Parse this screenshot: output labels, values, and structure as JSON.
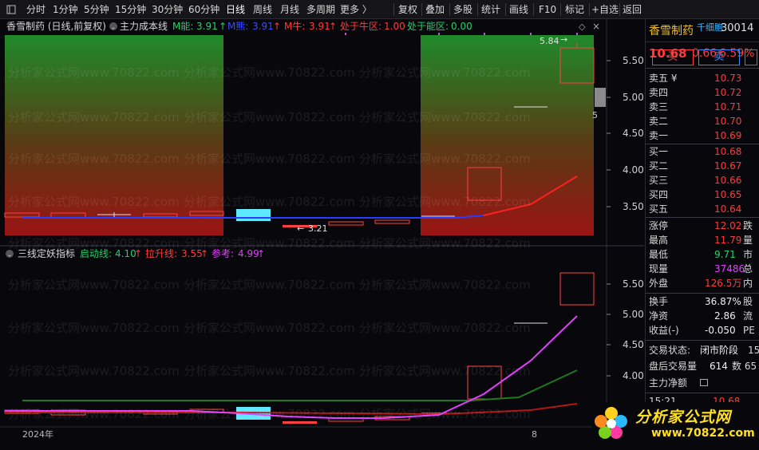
{
  "toolbar": {
    "items": [
      "分时",
      "1分钟",
      "5分钟",
      "15分钟",
      "30分钟",
      "60分钟",
      "日线",
      "周线",
      "月线",
      "多周期",
      "更多 〉",
      "复权",
      "叠加",
      "多股",
      "统计",
      "画线",
      "F10",
      "标记",
      "+自选",
      "返回"
    ],
    "active": "日线"
  },
  "upper": {
    "title": "香雪制药 (日线,前复权)",
    "indicator": "主力成本线",
    "m_neng_label": "M能:",
    "m_neng_value": "3.91",
    "m_xiong_label": "M熊:",
    "m_xiong_value": "3.91",
    "m_niu_label": "M牛:",
    "m_niu_value": "3.91",
    "niu_zone_label": "处于牛区:",
    "niu_zone_value": "1.00",
    "neng_zone_label": "处于能区:",
    "neng_zone_value": "0.00",
    "high_marker": "5.84",
    "low_marker": "3.21",
    "axis_ticks": [
      "5.50",
      "5.00",
      "4.50",
      "4.00",
      "3.50"
    ],
    "side_label": "5"
  },
  "lower": {
    "indicator": "三线定妖指标",
    "qidong_label": "启动线:",
    "qidong_value": "4.10",
    "lasheng_label": "拉升线:",
    "lasheng_value": "3.55",
    "cankao_label": "参考:",
    "cankao_value": "4.99",
    "axis_ticks": [
      "5.50",
      "5.00",
      "4.50",
      "4.00"
    ],
    "year_label": "2024年",
    "bottom_marker": "8"
  },
  "quote": {
    "name": "香雪制药",
    "tag": "千细胞",
    "code": "30014",
    "price": "10.68",
    "change": "0.66",
    "change_pct": "6.59%",
    "buy_label": "买",
    "sell_label": "卖",
    "asks": [
      {
        "label": "卖五 ¥",
        "price": "10.73"
      },
      {
        "label": "卖四",
        "price": "10.72"
      },
      {
        "label": "卖三",
        "price": "10.71"
      },
      {
        "label": "卖二",
        "price": "10.70"
      },
      {
        "label": "卖一",
        "price": "10.69"
      }
    ],
    "bids": [
      {
        "label": "买一",
        "price": "10.68"
      },
      {
        "label": "买二",
        "price": "10.67"
      },
      {
        "label": "买三",
        "price": "10.66"
      },
      {
        "label": "买四",
        "price": "10.65"
      },
      {
        "label": "买五",
        "price": "10.64"
      }
    ],
    "stats": [
      {
        "label": "涨停",
        "value": "12.02",
        "trail": "跌"
      },
      {
        "label": "最高",
        "value": "11.79",
        "trail": "量"
      },
      {
        "label": "最低",
        "value": "9.71",
        "trail": "市"
      },
      {
        "label": "现量",
        "value": "37486",
        "trail": "总"
      },
      {
        "label": "外盘",
        "value": "126.5万",
        "trail": "内"
      }
    ],
    "stats2": [
      {
        "label": "换手",
        "value": "36.87%",
        "trail": "股"
      },
      {
        "label": "净资",
        "value": "2.86",
        "trail": "流"
      },
      {
        "label": "收益(-)",
        "value": "-0.050",
        "trail": "PE"
      }
    ],
    "trade_status_label": "交易状态:",
    "trade_status_value": "闭市阶段",
    "trade_status_trail": "15",
    "after_label": "盘后交易量",
    "after_value": "614",
    "after_trail": "数 65",
    "main_net_label": "主力净额",
    "last_time": "15:21",
    "last_price": "10.68"
  },
  "watermark": "分析家公式网www.70822.com",
  "logo": {
    "line1": "分析家公式网",
    "line2": "www.70822.com"
  }
}
